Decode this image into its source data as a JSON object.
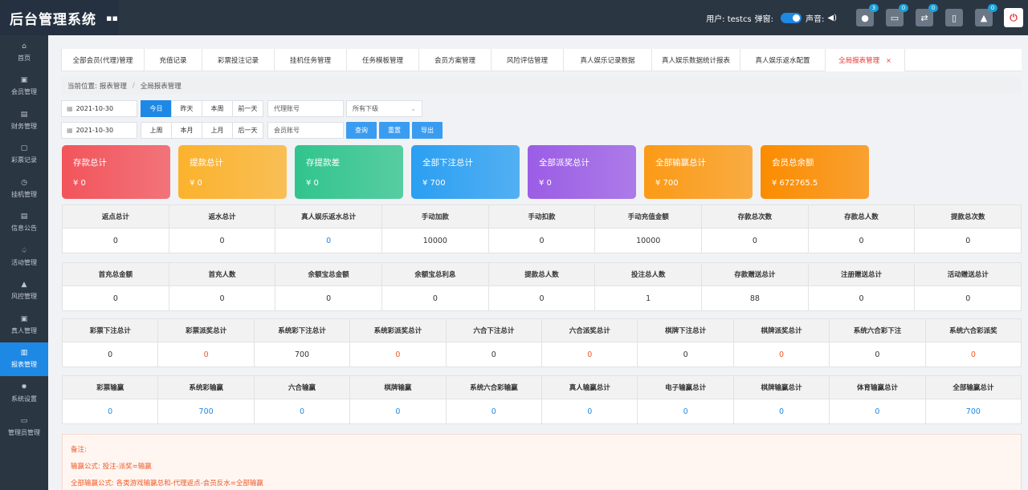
{
  "header": {
    "app_title": "后台管理系统",
    "user_label": "用户: testcs",
    "popup_label": "弹窗:",
    "sound_label": "声音:",
    "badges": [
      "3",
      "0",
      "0",
      "0"
    ]
  },
  "sidebar": {
    "items": [
      {
        "label": "首页",
        "icon": "home-icon",
        "glyph": "⌂"
      },
      {
        "label": "会员管理",
        "icon": "user-icon",
        "glyph": "▣"
      },
      {
        "label": "财务管理",
        "icon": "finance-icon",
        "glyph": "▤"
      },
      {
        "label": "彩票记录",
        "icon": "lottery-icon",
        "glyph": "▢"
      },
      {
        "label": "挂机管理",
        "icon": "clock-icon",
        "glyph": "◷"
      },
      {
        "label": "信息公告",
        "icon": "notice-icon",
        "glyph": "▤"
      },
      {
        "label": "活动管理",
        "icon": "bell-icon",
        "glyph": "♤"
      },
      {
        "label": "风控管理",
        "icon": "warning-icon",
        "glyph": "▲"
      },
      {
        "label": "真人管理",
        "icon": "person-icon",
        "glyph": "▣"
      },
      {
        "label": "报表管理",
        "icon": "chart-icon",
        "glyph": "▥",
        "active": true
      },
      {
        "label": "系统设置",
        "icon": "gear-icon",
        "glyph": "✹"
      },
      {
        "label": "管理员管理",
        "icon": "admin-icon",
        "glyph": "▭"
      }
    ]
  },
  "tabs": [
    {
      "label": "全部会员(代理)管理"
    },
    {
      "label": "充值记录"
    },
    {
      "label": "彩票投注记录"
    },
    {
      "label": "挂机任务管理"
    },
    {
      "label": "任务模板管理"
    },
    {
      "label": "会员方案管理"
    },
    {
      "label": "风险评估管理"
    },
    {
      "label": "真人娱乐记录数据"
    },
    {
      "label": "真人娱乐数据统计报表"
    },
    {
      "label": "真人娱乐返水配置"
    },
    {
      "label": "全局报表管理",
      "active": true
    }
  ],
  "breadcrumb": {
    "prefix": "当前位置:",
    "parent": "报表管理",
    "current": "全局报表管理"
  },
  "filters": {
    "date_start": "2021-10-30",
    "date_end": "2021-10-30",
    "quick_row1": [
      "今日",
      "昨天",
      "本周",
      "前一天"
    ],
    "quick_row2": [
      "上周",
      "本月",
      "上月",
      "后一天"
    ],
    "agent_placeholder": "代理账号",
    "member_placeholder": "会员账号",
    "level_select": "所有下级",
    "search_label": "查询",
    "reset_label": "重置",
    "export_label": "导出"
  },
  "cards": [
    {
      "title": "存款总计",
      "value": "¥ 0",
      "color": "#f2545b"
    },
    {
      "title": "提款总计",
      "value": "¥ 0",
      "color": "#fbb22d"
    },
    {
      "title": "存提款差",
      "value": "¥ 0",
      "color": "#31c48d"
    },
    {
      "title": "全部下注总计",
      "value": "¥ 700",
      "color": "#2b9ff2"
    },
    {
      "title": "全部派奖总计",
      "value": "¥ 0",
      "color": "#9b5de5"
    },
    {
      "title": "全部输赢总计",
      "value": "¥ 700",
      "color": "#fb9a16"
    },
    {
      "title": "会员总余额",
      "value": "¥ 672765.5",
      "color": "#fb8c00"
    }
  ],
  "tables": [
    {
      "headers": [
        "返点总计",
        "返水总计",
        "真人娱乐返水总计",
        "手动加款",
        "手动扣款",
        "手动充值金额",
        "存款总次数",
        "存款总人数",
        "提款总次数"
      ],
      "values": [
        "0",
        "0",
        "0",
        "10000",
        "0",
        "10000",
        "0",
        "0",
        "0"
      ],
      "value_colors": [
        "",
        "",
        "blue",
        "",
        "",
        "",
        "",
        "",
        ""
      ]
    },
    {
      "headers": [
        "首充总金额",
        "首充人数",
        "余额宝总金额",
        "余额宝总利息",
        "提款总人数",
        "投注总人数",
        "存款赠送总计",
        "注册赠送总计",
        "活动赠送总计"
      ],
      "values": [
        "0",
        "0",
        "0",
        "0",
        "0",
        "1",
        "88",
        "0",
        "0"
      ],
      "value_colors": [
        "",
        "",
        "",
        "",
        "",
        "",
        "",
        "",
        ""
      ]
    },
    {
      "headers": [
        "彩票下注总计",
        "彩票派奖总计",
        "系统彩下注总计",
        "系统彩派奖总计",
        "六合下注总计",
        "六合派奖总计",
        "棋牌下注总计",
        "棋牌派奖总计",
        "系统六合彩下注",
        "系统六合彩派奖"
      ],
      "values": [
        "0",
        "0",
        "700",
        "0",
        "0",
        "0",
        "0",
        "0",
        "0",
        "0"
      ],
      "value_colors": [
        "",
        "red",
        "",
        "red",
        "",
        "red",
        "",
        "red",
        "",
        "red"
      ]
    },
    {
      "headers": [
        "彩票输赢",
        "系统彩输赢",
        "六合输赢",
        "棋牌输赢",
        "系统六合彩输赢",
        "真人输赢总计",
        "电子输赢总计",
        "棋牌输赢总计",
        "体育输赢总计",
        "全部输赢总计"
      ],
      "values": [
        "0",
        "700",
        "0",
        "0",
        "0",
        "0",
        "0",
        "0",
        "0",
        "700"
      ],
      "value_colors": [
        "blue",
        "blue",
        "blue",
        "blue",
        "blue",
        "blue",
        "blue",
        "blue",
        "blue",
        "blue"
      ]
    }
  ],
  "notes": {
    "title": "备注:",
    "lines": [
      "输赢公式: 投注-派奖=输赢",
      "全部输赢公式: 各类游戏输赢总和-代理返点-会员反水=全部输赢"
    ]
  }
}
